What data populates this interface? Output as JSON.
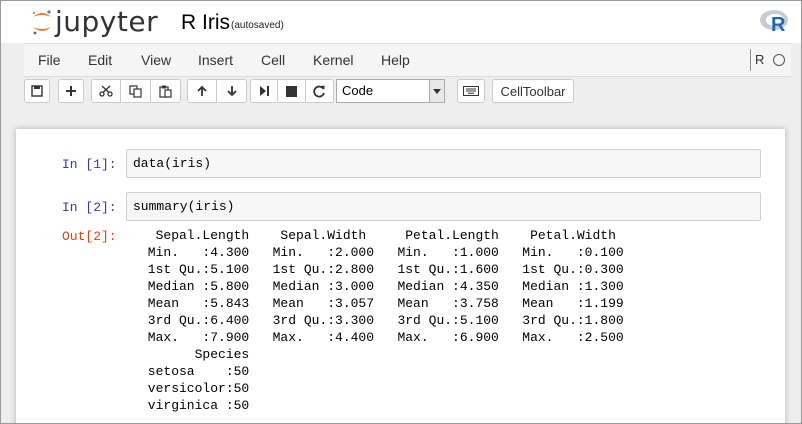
{
  "header": {
    "logo_text": "jupyter",
    "notebook_name": "R Iris",
    "autosave_status": "(autosaved)",
    "kernel_logo": "R"
  },
  "menubar": {
    "items": [
      "File",
      "Edit",
      "View",
      "Insert",
      "Cell",
      "Kernel",
      "Help"
    ],
    "kernel_indicator": "R"
  },
  "toolbar": {
    "cell_type": "Code",
    "celltoolbar_label": "CellToolbar",
    "icons": [
      "save-icon",
      "plus-icon",
      "scissors-icon",
      "copy-icon",
      "paste-icon",
      "arrow-up-icon",
      "arrow-down-icon",
      "run-icon",
      "stop-icon",
      "restart-icon",
      "keyboard-icon"
    ]
  },
  "cells": [
    {
      "prompt": "In [1]:",
      "source": "data(iris)"
    },
    {
      "prompt": "In [2]:",
      "source": "summary(iris)"
    }
  ],
  "output": {
    "prompt": "Out[2]:",
    "text": "  Sepal.Length    Sepal.Width     Petal.Length    Petal.Width   \n Min.   :4.300   Min.   :2.000   Min.   :1.000   Min.   :0.100  \n 1st Qu.:5.100   1st Qu.:2.800   1st Qu.:1.600   1st Qu.:0.300  \n Median :5.800   Median :3.000   Median :4.350   Median :1.300  \n Mean   :5.843   Mean   :3.057   Mean   :3.758   Mean   :1.199  \n 3rd Qu.:6.400   3rd Qu.:3.300   3rd Qu.:5.100   3rd Qu.:1.800  \n Max.   :7.900   Max.   :4.400   Max.   :6.900   Max.   :2.500  \n       Species  \n setosa    :50  \n versicolor:50  \n virginica :50  "
  },
  "colors": {
    "in_prompt": "#303F9F",
    "out_prompt": "#D84315",
    "logo_orange": "#F37626"
  }
}
